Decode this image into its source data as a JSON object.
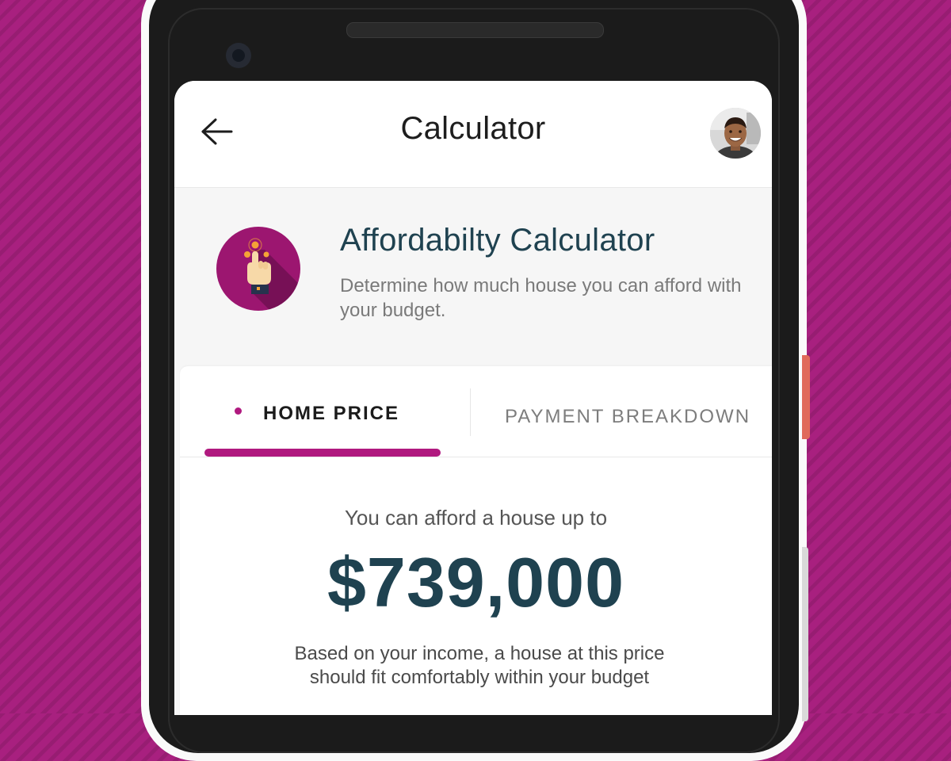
{
  "app_bar": {
    "title": "Calculator",
    "back_icon": "arrow-left-icon",
    "avatar": "user-avatar"
  },
  "header": {
    "icon": "hand-pointer-icon",
    "title": "Affordabilty Calculator",
    "description": "Determine how much house you can afford with your budget."
  },
  "tabs": [
    {
      "label": "HOME PRICE",
      "active": true
    },
    {
      "label": "PAYMENT BREAKDOWN",
      "active": false
    }
  ],
  "result": {
    "lead": "You can afford a house up to",
    "price": "$739,000",
    "note": "Based on your income, a house at this price should fit comfortably within your budget"
  },
  "colors": {
    "accent": "#b0197f",
    "heading": "#1f4250",
    "background": "#a8207f"
  }
}
